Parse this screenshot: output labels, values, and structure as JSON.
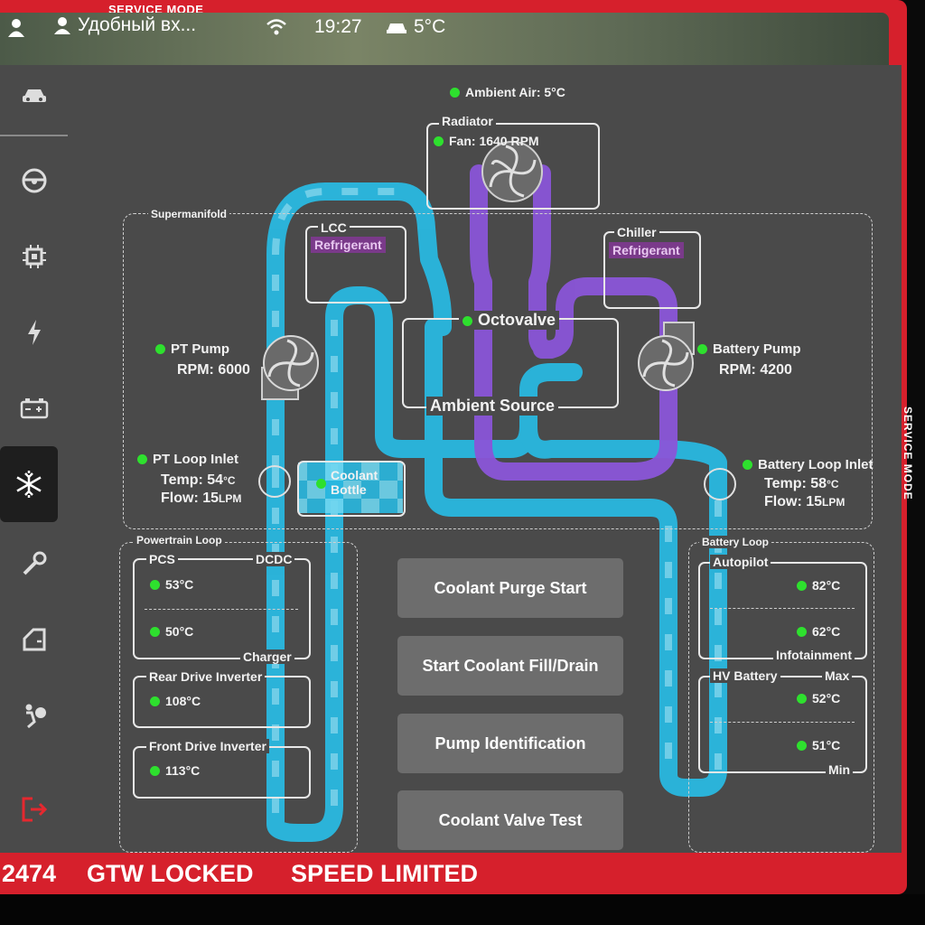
{
  "service_mode_label": "SERVICE MODE",
  "status": {
    "driver_name": "Удобный вх...",
    "time": "19:27",
    "temperature": "5°C"
  },
  "sidebar": {
    "items": [
      {
        "icon": "car-icon"
      },
      {
        "icon": "steering-wheel-icon"
      },
      {
        "icon": "chip-icon"
      },
      {
        "icon": "lightning-icon"
      },
      {
        "icon": "battery-icon"
      },
      {
        "icon": "snowflake-icon",
        "active": true
      },
      {
        "icon": "wrench-icon"
      },
      {
        "icon": "door-icon"
      },
      {
        "icon": "airbag-icon"
      },
      {
        "icon": "exit-icon"
      }
    ]
  },
  "diagram": {
    "ambient_air": "Ambient Air: 5°C",
    "radiator_title": "Radiator",
    "radiator_fan": "Fan: 1640 RPM",
    "supermanifold": "Supermanifold",
    "lcc_title": "LCC",
    "lcc_tag": "Refrigerant",
    "chiller_title": "Chiller",
    "chiller_tag": "Refrigerant",
    "octovalve": "Octovalve",
    "ambient_source": "Ambient Source",
    "pt_pump": "PT Pump",
    "pt_pump_rpm_label": "RPM:",
    "pt_pump_rpm": "6000",
    "battery_pump": "Battery Pump",
    "battery_pump_rpm_label": "RPM:",
    "battery_pump_rpm": "4200",
    "pt_loop_inlet": "PT Loop Inlet",
    "pt_temp_label": "Temp:",
    "pt_temp": "54",
    "pt_temp_unit": "°C",
    "pt_flow_label": "Flow:",
    "pt_flow": "15",
    "pt_flow_unit": "LPM",
    "coolant_bottle": "Coolant Bottle",
    "battery_loop_inlet": "Battery Loop Inlet",
    "bat_temp_label": "Temp:",
    "bat_temp": "58",
    "bat_temp_unit": "°C",
    "bat_flow_label": "Flow:",
    "bat_flow": "15",
    "bat_flow_unit": "LPM",
    "powertrain_loop": {
      "title": "Powertrain Loop",
      "pcs": "PCS",
      "dcdc": "DCDC",
      "pcs_temp1": "53°C",
      "pcs_temp2": "50°C",
      "charger": "Charger",
      "rear_inverter": "Rear Drive Inverter",
      "rear_temp": "108°C",
      "front_inverter": "Front Drive Inverter",
      "front_temp": "113°C"
    },
    "battery_loop": {
      "title": "Battery Loop",
      "autopilot": "Autopilot",
      "autopilot_temp": "82°C",
      "infotainment_temp": "62°C",
      "infotainment": "Infotainment",
      "hv_battery": "HV Battery",
      "max": "Max",
      "max_temp": "52°C",
      "min_temp": "51°C",
      "min": "Min"
    }
  },
  "buttons": {
    "purge": "Coolant Purge Start",
    "fill_drain": "Start Coolant Fill/Drain",
    "pump_id": "Pump Identification",
    "valve_test": "Coolant Valve Test"
  },
  "bottom": {
    "code": "2474",
    "gtw": "GTW LOCKED",
    "speed": "SPEED LIMITED"
  },
  "colors": {
    "coolant": "#29b8e0",
    "refrigerant": "#8a55d8",
    "frame": "#d6202c",
    "status_ok": "#2ee02e"
  }
}
